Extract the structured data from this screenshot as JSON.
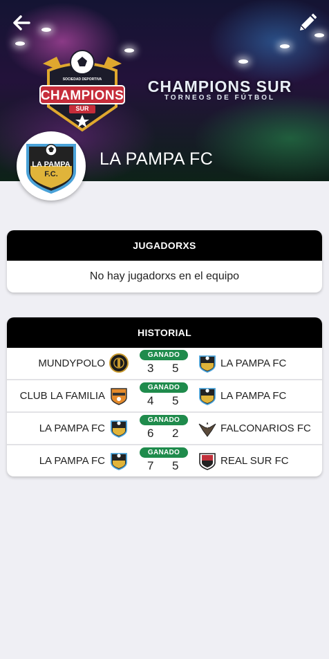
{
  "header": {
    "brand_title": "CHAMPIONS SUR",
    "brand_subtitle": "TORNEOS DE FÚTBOL",
    "logo_text": "CHAMPIONS",
    "logo_ribbon": "SUR",
    "logo_top_text": "SOCIEDAD DEPORTIVA",
    "team_name": "LA PAMPA FC",
    "team_logo_line1": "LA PAMPA",
    "team_logo_line2": "F.C."
  },
  "players": {
    "title": "JUGADORXS",
    "empty_message": "No hay jugadorxs en el equipo"
  },
  "history": {
    "title": "HISTORIAL",
    "matches": [
      {
        "home": "MUNDYPOLO",
        "away": "LA PAMPA FC",
        "status": "GANADO",
        "home_score": "3",
        "away_score": "5",
        "home_logo": "mundypolo-crest-icon",
        "away_logo": "la-pampa-crest-icon"
      },
      {
        "home": "CLUB LA FAMILIA",
        "away": "LA PAMPA FC",
        "status": "GANADO",
        "home_score": "4",
        "away_score": "5",
        "home_logo": "club-la-familia-crest-icon",
        "away_logo": "la-pampa-crest-icon"
      },
      {
        "home": "LA PAMPA FC",
        "away": "FALCONARIOS FC",
        "status": "GANADO",
        "home_score": "6",
        "away_score": "2",
        "home_logo": "la-pampa-crest-icon",
        "away_logo": "falconarios-crest-icon"
      },
      {
        "home": "LA PAMPA FC",
        "away": "REAL SUR FC",
        "status": "GANADO",
        "home_score": "7",
        "away_score": "5",
        "home_logo": "la-pampa-crest-icon",
        "away_logo": "real-sur-crest-icon"
      }
    ]
  },
  "colors": {
    "won_badge": "#1f8b4c",
    "card_header": "#000000",
    "background": "#efeff4"
  }
}
